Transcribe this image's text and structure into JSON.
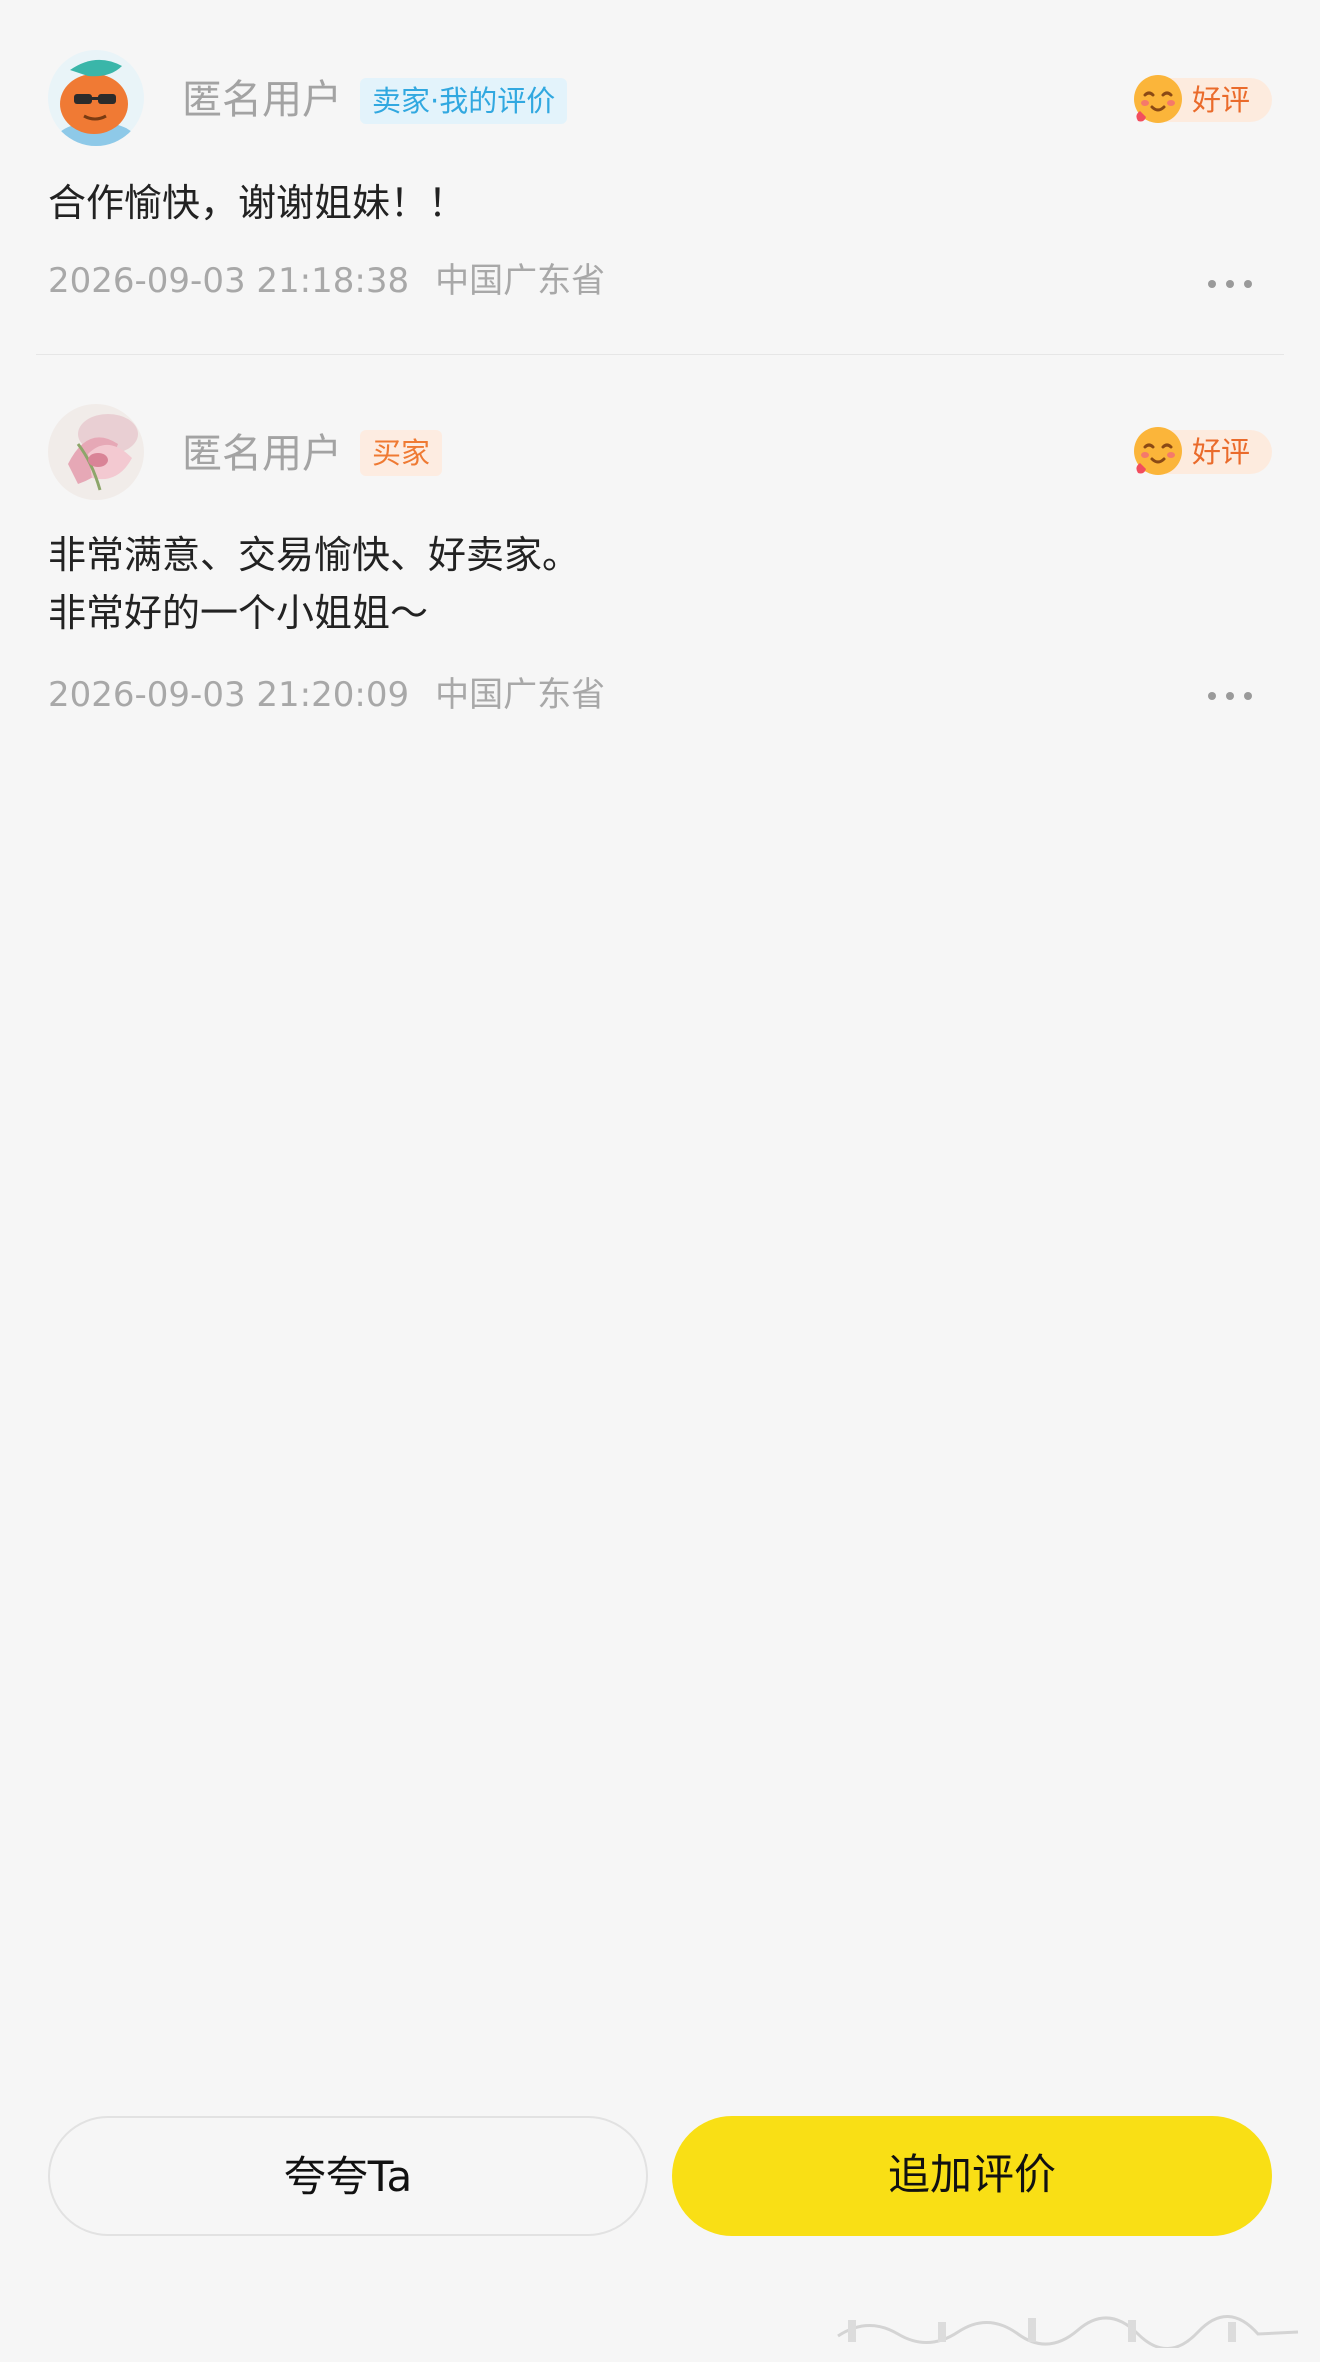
{
  "reviews": [
    {
      "username": "匿名用户",
      "role_tag": "卖家·我的评价",
      "rating": "好评",
      "content_lines": [
        "合作愉快，谢谢姐妹！！"
      ],
      "timestamp": "2026-09-03 21:18:38",
      "location": "中国广东省",
      "avatar": "cartoon-avatar-icon",
      "role_tag_color": "#31a8e0"
    },
    {
      "username": "匿名用户",
      "role_tag": "买家",
      "rating": "好评",
      "content_lines": [
        "非常满意、交易愉快、好卖家。",
        "非常好的一个小姐姐～"
      ],
      "timestamp": "2026-09-03 21:20:09",
      "location": "中国广东省",
      "avatar": "flower-avatar-icon",
      "role_tag_color": "#ef7a33"
    }
  ],
  "actions": {
    "praise_label": "夸夸Ta",
    "add_review_label": "追加评价"
  },
  "colors": {
    "background": "#f6f6f6",
    "accent_yellow": "#f9df15",
    "rating_text": "#ea6b2b"
  }
}
